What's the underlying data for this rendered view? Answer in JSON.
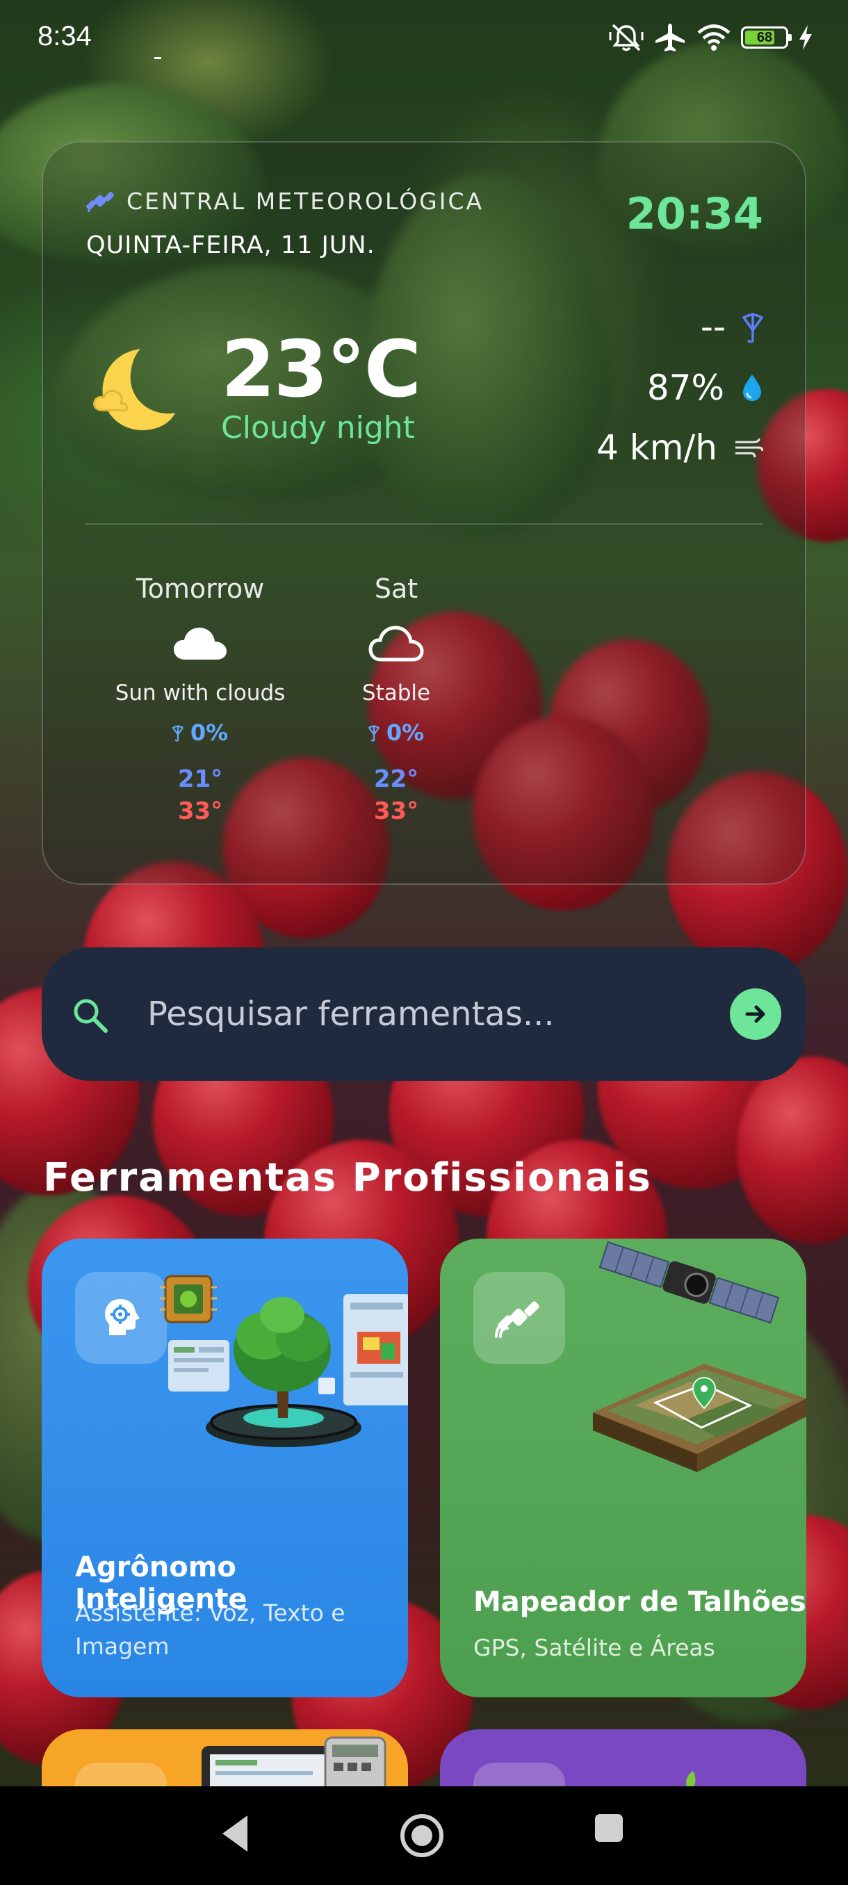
{
  "status_bar": {
    "time": "8:34",
    "battery": "68",
    "icons": [
      "mute-vibrate-icon",
      "airplane-icon",
      "wifi-icon",
      "battery-icon",
      "charging-icon"
    ]
  },
  "weather": {
    "station_label": "CENTRAL METEOROLÓGICA",
    "date": "QUINTA-FEIRA, 11 JUN.",
    "time": "20:34",
    "temperature": "23°C",
    "condition": "Cloudy night",
    "rain": "--",
    "humidity": "87%",
    "wind": "4 km/h",
    "forecast": [
      {
        "day": "Tomorrow",
        "description": "Sun with clouds",
        "rain": "0%",
        "min": "21°",
        "max": "33°",
        "icon": "cloud-filled-icon"
      },
      {
        "day": "Sat",
        "description": "Stable",
        "rain": "0%",
        "min": "22°",
        "max": "33°",
        "icon": "cloud-outline-icon"
      }
    ]
  },
  "search": {
    "placeholder": "Pesquisar ferramentas..."
  },
  "tools": {
    "section_title": "Ferramentas Profissionais",
    "cards": [
      {
        "title": "Agrônomo Inteligente",
        "subtitle": "Assistente: Voz, Texto e Imagem",
        "color": "#3a96ee",
        "icon": "brain-gear-icon"
      },
      {
        "title": "Mapeador de Talhões",
        "subtitle": "GPS, Satélite e Áreas",
        "color": "#5cae5e",
        "icon": "satellite-icon"
      }
    ]
  },
  "colors": {
    "accent_green": "#6ee69a",
    "search_bg": "#202a3e",
    "min_temp": "#6a8dff",
    "max_temp": "#ff5a5a",
    "rain_blue": "#63a8ff"
  }
}
